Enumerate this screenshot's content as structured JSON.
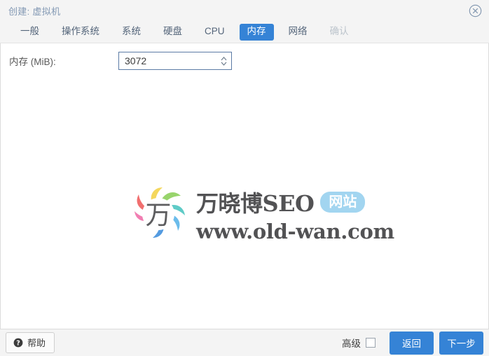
{
  "window": {
    "title": "创建: 虚拟机",
    "close_icon": "close-circle-icon"
  },
  "tabs": [
    {
      "label": "一般",
      "state": "normal"
    },
    {
      "label": "操作系统",
      "state": "normal"
    },
    {
      "label": "系统",
      "state": "normal"
    },
    {
      "label": "硬盘",
      "state": "normal"
    },
    {
      "label": "CPU",
      "state": "normal"
    },
    {
      "label": "内存",
      "state": "active"
    },
    {
      "label": "网络",
      "state": "normal"
    },
    {
      "label": "确认",
      "state": "disabled"
    }
  ],
  "form": {
    "memory_label": "内存 (MiB):",
    "memory_value": "3072",
    "spinner_icon": "spinner-updown-icon"
  },
  "watermark": {
    "logo_glyph": "万",
    "brand": "万晓博SEO",
    "badge": "网站",
    "url": "www.old-wan.com",
    "petal_colors": [
      "#f3d24a",
      "#8ccf5a",
      "#4cc4c0",
      "#59b4e8",
      "#3f8fdc",
      "#9c7fd0",
      "#ef6fa8",
      "#ee5a5a",
      "#f39a4a"
    ]
  },
  "footer": {
    "help_label": "帮助",
    "help_icon": "question-mark-icon",
    "advanced_label": "高级",
    "advanced_checked": false,
    "back_label": "返回",
    "next_label": "下一步"
  },
  "colors": {
    "accent": "#3583d6",
    "title_text": "#8399b4",
    "badge": "#9fd4f0",
    "input_border": "#5b7ba5"
  }
}
